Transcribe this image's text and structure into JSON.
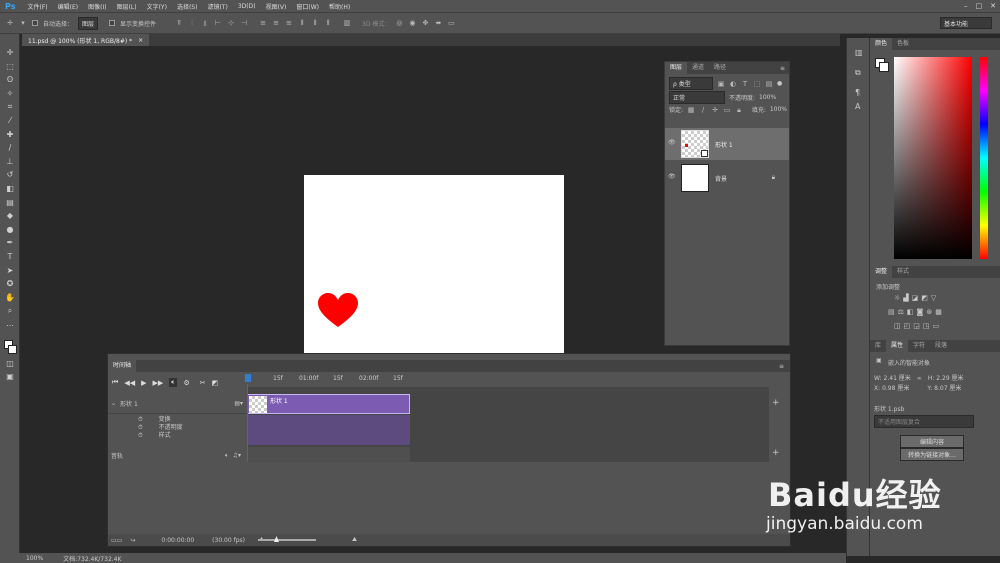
{
  "app": {
    "logo": "Ps",
    "menus": [
      "文件(F)",
      "编辑(E)",
      "图像(I)",
      "图层(L)",
      "文字(Y)",
      "选择(S)",
      "滤镜(T)",
      "3D(D)",
      "视图(V)",
      "窗口(W)",
      "帮助(H)"
    ]
  },
  "options": {
    "auto_select": "自动选择：",
    "auto_select_target": "图层",
    "show_transform": "显示变换控件",
    "mode_3d": "3D 模式：",
    "workspace": "基本功能"
  },
  "document": {
    "tab_title": "11.psd @ 100% (形状 1, RGB/8#) *",
    "close": "×"
  },
  "layers_panel": {
    "tabs": [
      "图层",
      "通道",
      "路径"
    ],
    "filter_kind": "ρ 类型",
    "blend_mode": "正常",
    "opacity_label": "不透明度:",
    "opacity": "100%",
    "lock_label": "锁定:",
    "fill_label": "填充:",
    "fill": "100%",
    "layers": [
      {
        "name": "形状 1",
        "selected": true
      },
      {
        "name": "背景",
        "selected": false
      }
    ]
  },
  "color_panel": {
    "tabs": [
      "颜色",
      "色板"
    ]
  },
  "adjust_panel": {
    "tabs": [
      "调整",
      "样式"
    ],
    "title": "添加调整"
  },
  "props_panel": {
    "tabs": [
      "库",
      "属性",
      "字符",
      "段落"
    ],
    "title": "嵌入的智能对象",
    "w_label": "W:",
    "w": "2.41 厘米",
    "h_label": "H:",
    "h": "2.29 厘米",
    "x_label": "X:",
    "x": "0.98 厘米",
    "y_label": "Y:",
    "y": "8.07 厘米",
    "file": "形状 1.psb",
    "layer_comp": "不适用图层复合",
    "edit_btn": "编辑内容",
    "convert_btn": "转换为链接对象..."
  },
  "timeline": {
    "title": "时间轴",
    "ruler": [
      "15f",
      "01:00f",
      "15f",
      "02:00f",
      "15f"
    ],
    "layer": "形状 1",
    "clip": "形状 1",
    "props": [
      "变换",
      "不透明度",
      "样式"
    ],
    "audio": "音轨",
    "time": "0:00:00:00",
    "fps": "(30.00 fps)"
  },
  "status": {
    "zoom": "100%",
    "doc": "文档:732.4K/732.4K"
  },
  "watermark": {
    "brand": "Baidu经验",
    "url": "jingyan.baidu.com"
  },
  "colors": {
    "heart": "#ff0000",
    "clip": "#7c5cb3"
  }
}
